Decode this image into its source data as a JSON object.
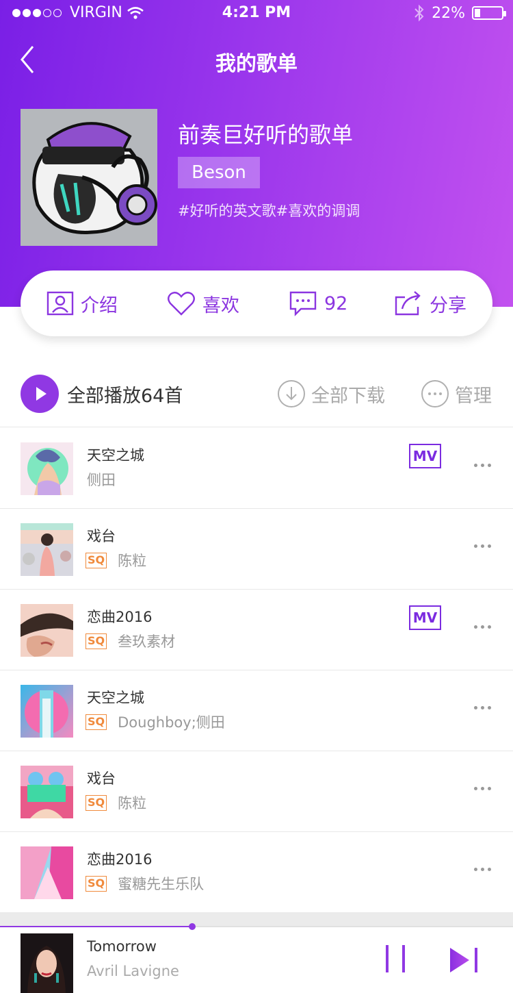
{
  "status_bar": {
    "carrier": "VIRGIN",
    "time": "4:21 PM",
    "battery": "22%"
  },
  "nav": {
    "title": "我的歌单"
  },
  "playlist": {
    "title": "前奏巨好听的歌单",
    "creator": "Beson",
    "tags": "#好听的英文歌#喜欢的调调"
  },
  "actions": {
    "intro": "介绍",
    "like": "喜欢",
    "comments": "92",
    "share": "分享"
  },
  "toolbar": {
    "play_all": "全部播放64首",
    "download_all": "全部下载",
    "manage": "管理"
  },
  "badges": {
    "sq": "SQ",
    "mv": "MV"
  },
  "songs": [
    {
      "title": "天空之城",
      "artist": "侧田",
      "sq": false,
      "mv": true
    },
    {
      "title": "戏台",
      "artist": "陈粒",
      "sq": true,
      "mv": false
    },
    {
      "title": "恋曲2016",
      "artist": "叁玖素材",
      "sq": true,
      "mv": true
    },
    {
      "title": "天空之城",
      "artist": "Doughboy;侧田",
      "sq": true,
      "mv": false
    },
    {
      "title": "戏台",
      "artist": "陈粒",
      "sq": true,
      "mv": false
    },
    {
      "title": "恋曲2016",
      "artist": "蜜糖先生乐队",
      "sq": true,
      "mv": false
    }
  ],
  "now_playing": {
    "title": "Tomorrow",
    "artist": "Avril Lavigne",
    "progress": 0.375
  },
  "colors": {
    "accent": "#9038e3",
    "hero_start": "#7a1fe6",
    "hero_end": "#c251ef",
    "sq": "#f08a3c"
  }
}
